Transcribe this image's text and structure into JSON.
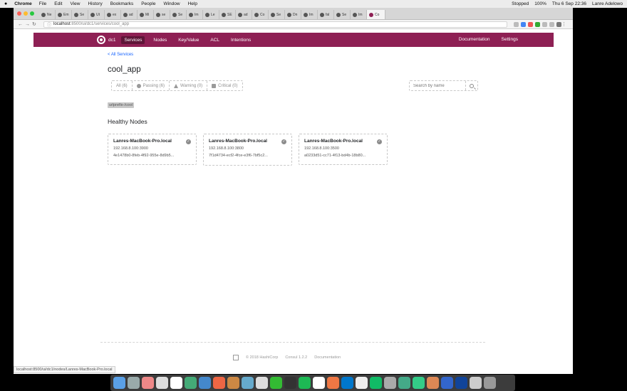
{
  "menubar": {
    "apple": "",
    "app": "Chrome",
    "items": [
      "File",
      "Edit",
      "View",
      "History",
      "Bookmarks",
      "People",
      "Window",
      "Help"
    ],
    "status": [
      "Stopped",
      "100%",
      "Thu 6 Sep 22:36",
      "Lanre Adelowo"
    ]
  },
  "tabs": [
    "Ne",
    "Em",
    "Se",
    "Ut",
    "ex",
    "ad",
    "Mi",
    "se",
    "Se",
    "Im",
    "Le",
    "SE",
    "ad",
    "Co",
    "Se",
    "Dn",
    "Im",
    "fal",
    "Se",
    "Im",
    "Co"
  ],
  "address": {
    "host": "localhost",
    "path": ":8500/ui/dc1/services/cool_app"
  },
  "nav": {
    "dc": "dc1",
    "items": [
      "Services",
      "Nodes",
      "Key/Value",
      "ACL",
      "Intentions"
    ],
    "right": [
      "Documentation",
      "Settings"
    ]
  },
  "page": {
    "back_link": "< All Services",
    "title": "cool_app",
    "filters": [
      {
        "label": "All (6)",
        "icon": "none"
      },
      {
        "label": "Passing (6)",
        "icon": "check-circle-icon"
      },
      {
        "label": "Warning (0)",
        "icon": "warning-icon"
      },
      {
        "label": "Critical (0)",
        "icon": "critical-icon"
      }
    ],
    "search_placeholder": "Search by name",
    "tag": "urlprefix-/cool",
    "section_title": "Healthy Nodes",
    "nodes": [
      {
        "name": "Lanres-MacBook-Pro.local",
        "address": "192.168.8.100:3900",
        "id": "4e1478b0-8feb-4f92-955e-8d9b5..."
      },
      {
        "name": "Lanres-MacBook-Pro.local",
        "address": "192.168.8.100:3800",
        "id": "7f1d4734-ecf2-4fce-e3f6-7bf5c2..."
      },
      {
        "name": "Lanres-MacBook-Pro.local",
        "address": "192.168.8.100:3500",
        "id": "a0233d51-cc71-4f13-bd4b-18b80..."
      }
    ],
    "footer": [
      "© 2018 HashiCorp",
      "Consul 1.2.2",
      "Documentation"
    ]
  },
  "statusbar": "localhost:8500/ui/dc1/nodes/Lanres-MacBook-Pro.local"
}
